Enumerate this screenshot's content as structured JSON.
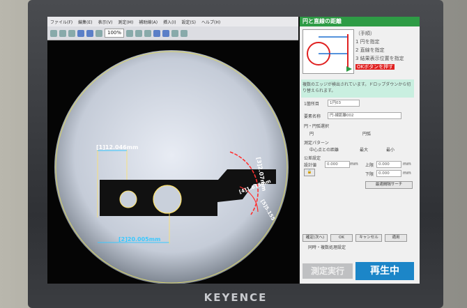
{
  "device": {
    "brand": "KEYENCE"
  },
  "menu": [
    "ファイル(F)",
    "編集(E)",
    "表示(V)",
    "測定(M)",
    "補助線(A)",
    "挿入(I)",
    "設定(S)",
    "ヘルプ(H)"
  ],
  "toolbar": {
    "zoom": "100%",
    "icons": [
      "open-icon",
      "save-icon",
      "print-icon",
      "undo-icon",
      "redo-icon",
      "delete-icon",
      "pointer-icon",
      "text-icon",
      "line-icon",
      "select-icon",
      "grid-icon",
      "color-icon"
    ]
  },
  "measurements": {
    "m1": "[1]12.046mm",
    "m2": "[2]20.005mm",
    "m3": "[3]2.07mm",
    "m4": "[4]1.613mm",
    "m5": "[5]5.155"
  },
  "panel": {
    "title": "円と直線の距離",
    "steps_header": "（手順）",
    "steps": [
      "1 円を指定",
      "2 直線を指定",
      "3 結果表示位置を指定"
    ],
    "step_hint": "OKボタンを押す",
    "notice": "複数のエッジが検出されています。ドロップダウンから切り替えられます。",
    "candidate_label": "1箇所目",
    "candidate_value": "1円03",
    "item_name_label": "要素名称",
    "item_name_value": "円-線距離002",
    "circle_select_label": "円・円弧選択",
    "circle_opt1": "円",
    "circle_opt2": "円弧",
    "pattern_label": "測定パターン",
    "pattern_opt1": "中心点との距離",
    "pattern_opt2": "最大",
    "pattern_opt3": "最小",
    "tolerance_label": "公差設定",
    "design_label": "設計値",
    "design_value": "0.000",
    "upper_label": "上限",
    "upper_value": "0.000",
    "lower_label": "下限",
    "lower_value": "0.000",
    "unit": "mm",
    "search_button": "最適間隔サーチ",
    "confirm_button": "確定(次へ)",
    "ok_button": "OK",
    "cancel_button": "キャンセル",
    "apply_button": "適用",
    "sync_label": "同時・複数処理設定",
    "run_button": "測定実行",
    "play_button": "再生中"
  },
  "colors": {
    "accent_green": "#2e9b45",
    "measure_cyan": "#39c8ff",
    "arc_red": "#ff3030",
    "play_blue": "#1c86c8"
  }
}
